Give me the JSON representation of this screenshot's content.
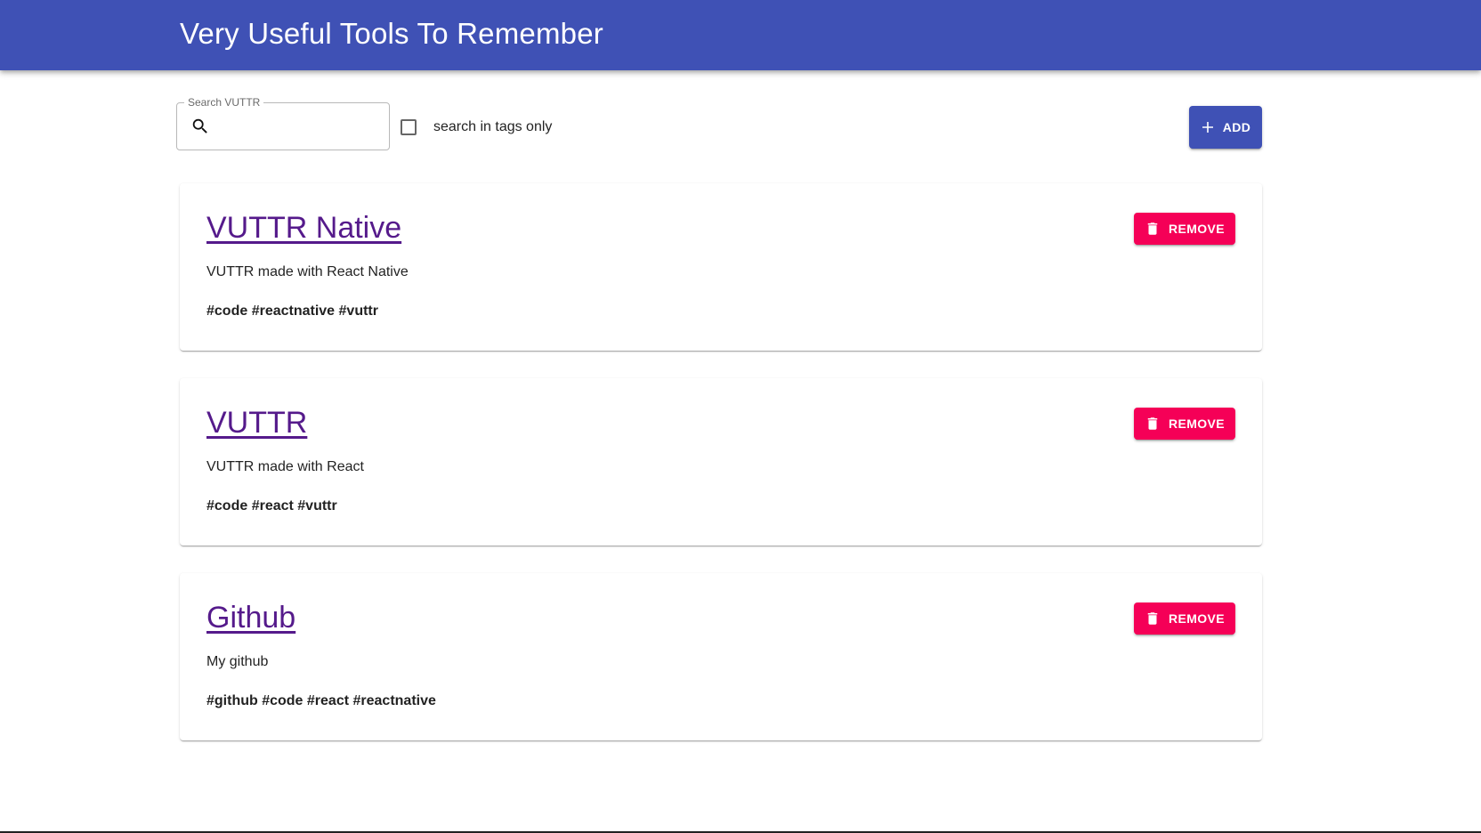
{
  "header": {
    "title": "Very Useful Tools To Remember"
  },
  "search": {
    "label": "Search VUTTR",
    "value": "",
    "placeholder": "",
    "icon": "search-icon"
  },
  "tags_filter": {
    "label": "search in tags only",
    "checked": false
  },
  "toolbar": {
    "add_label": "ADD",
    "add_icon": "plus-icon"
  },
  "colors": {
    "primary": "#3f51b5",
    "secondary": "#f50057",
    "link_visited": "#551a8b"
  },
  "tools": [
    {
      "title": "VUTTR Native",
      "description": "VUTTR made with React Native",
      "tags": "#code #reactnative #vuttr",
      "remove_label": "REMOVE"
    },
    {
      "title": "VUTTR",
      "description": "VUTTR made with React",
      "tags": "#code #react #vuttr",
      "remove_label": "REMOVE"
    },
    {
      "title": "Github",
      "description": "My github",
      "tags": "#github #code #react #reactnative",
      "remove_label": "REMOVE"
    }
  ]
}
